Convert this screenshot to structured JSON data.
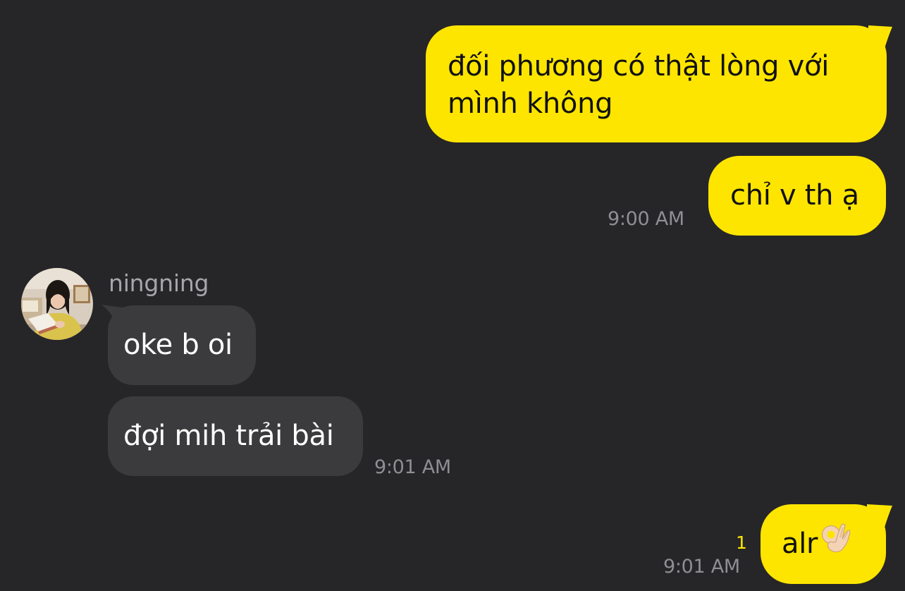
{
  "messages": [
    {
      "direction": "sent",
      "text": "đối phương có thật lòng với\nmình không"
    },
    {
      "direction": "sent",
      "text": "chỉ v th ạ",
      "time": "9:00 AM"
    },
    {
      "direction": "received",
      "sender": "ningning",
      "text": "oke b oi"
    },
    {
      "direction": "received",
      "text": "đợi mih trải bài",
      "time": "9:01 AM"
    },
    {
      "direction": "sent",
      "text": "alr",
      "emoji": "ok-hand-emoji",
      "time": "9:01 AM",
      "unread_count": "1"
    }
  ],
  "colors": {
    "background": "#262628",
    "sent_bubble": "#FEE500",
    "received_bubble": "#3B3B3D",
    "timestamp": "#8E8E93",
    "unread": "#FEE500"
  },
  "icons": {
    "avatar": "profile-photo-avatar",
    "emoji": "ok-hand-emoji"
  }
}
